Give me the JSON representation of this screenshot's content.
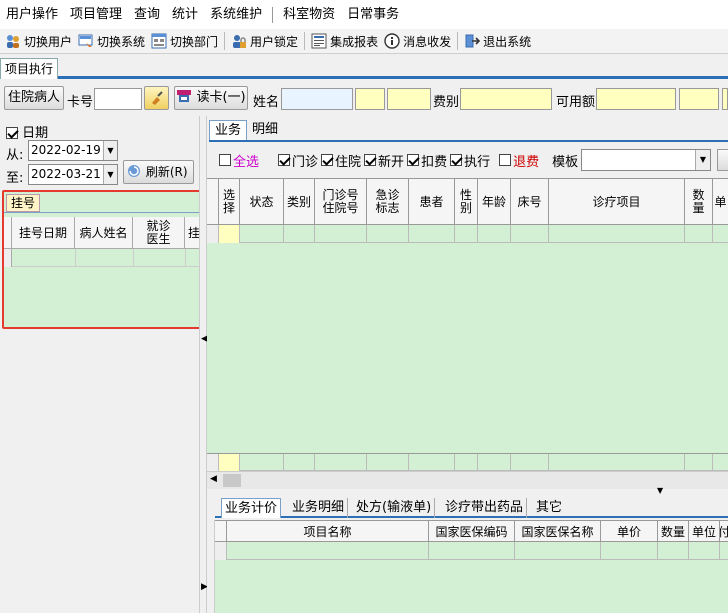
{
  "menu": [
    "用户操作",
    "项目管理",
    "查询",
    "统计",
    "系统维护",
    "科室物资",
    "日常事务"
  ],
  "toolbar": [
    {
      "label": "切换用户",
      "icon": "switch-user-icon"
    },
    {
      "label": "切换系统",
      "icon": "switch-system-icon"
    },
    {
      "label": "切换部门",
      "icon": "switch-dept-icon"
    },
    {
      "label": "用户锁定",
      "icon": "user-lock-icon"
    },
    {
      "label": "集成报表",
      "icon": "report-icon"
    },
    {
      "label": "消息收发",
      "icon": "message-icon"
    },
    {
      "label": "退出系统",
      "icon": "exit-icon"
    }
  ],
  "main_tab": "项目执行",
  "regbar": {
    "inpatient_btn": "住院病人",
    "card_label": "卡号",
    "read_card_btn": "读卡(一)",
    "name_label": "姓名",
    "fee_type_label": "费别",
    "available_label": "可用额"
  },
  "left": {
    "date_check": "日期",
    "from_label": "从:",
    "from_date": "2022-02-19",
    "to_label": "至:",
    "to_date": "2022-03-21",
    "refresh_btn": "刷新(R)",
    "guahao_tab": "挂号",
    "guahao_cols": [
      "挂号日期",
      "病人姓名",
      "就诊医生",
      "挂"
    ]
  },
  "right": {
    "tabs": [
      "业务",
      "明细"
    ],
    "filters": {
      "select_all": "全选",
      "outpatient": "门诊",
      "inpatient": "住院",
      "new_open": "新开",
      "deduct": "扣费",
      "execute": "执行",
      "refund": "退费",
      "template_label": "模板"
    },
    "main_cols": [
      "选择",
      "状态",
      "类别",
      "门诊号住院号",
      "急诊标志",
      "患者",
      "性别",
      "年龄",
      "床号",
      "诊疗项目",
      "数量",
      "单"
    ],
    "main_col_lines": [
      [
        "选",
        "择"
      ],
      [
        "状态"
      ],
      [
        "类别"
      ],
      [
        "门诊号",
        "住院号"
      ],
      [
        "急诊",
        "标志"
      ],
      [
        "患者"
      ],
      [
        "性",
        "别"
      ],
      [
        "年龄"
      ],
      [
        "床号"
      ],
      [
        "诊疗项目"
      ],
      [
        "数",
        "量"
      ],
      [
        "单"
      ]
    ],
    "bottom_tabs": [
      "业务计价",
      "业务明细",
      "处方(输液单)",
      "诊疗带出药品",
      "其它"
    ],
    "bottom_cols": [
      "项目名称",
      "国家医保编码",
      "国家医保名称",
      "单价",
      "数量",
      "单位",
      "付"
    ]
  },
  "colors": {
    "grid_bg": "#d4f0d4",
    "highlight_border": "#e53a2e",
    "tab_accent": "#2b6fb6",
    "select_all_color": "#cc00cc",
    "refund_color": "#cc0000"
  }
}
